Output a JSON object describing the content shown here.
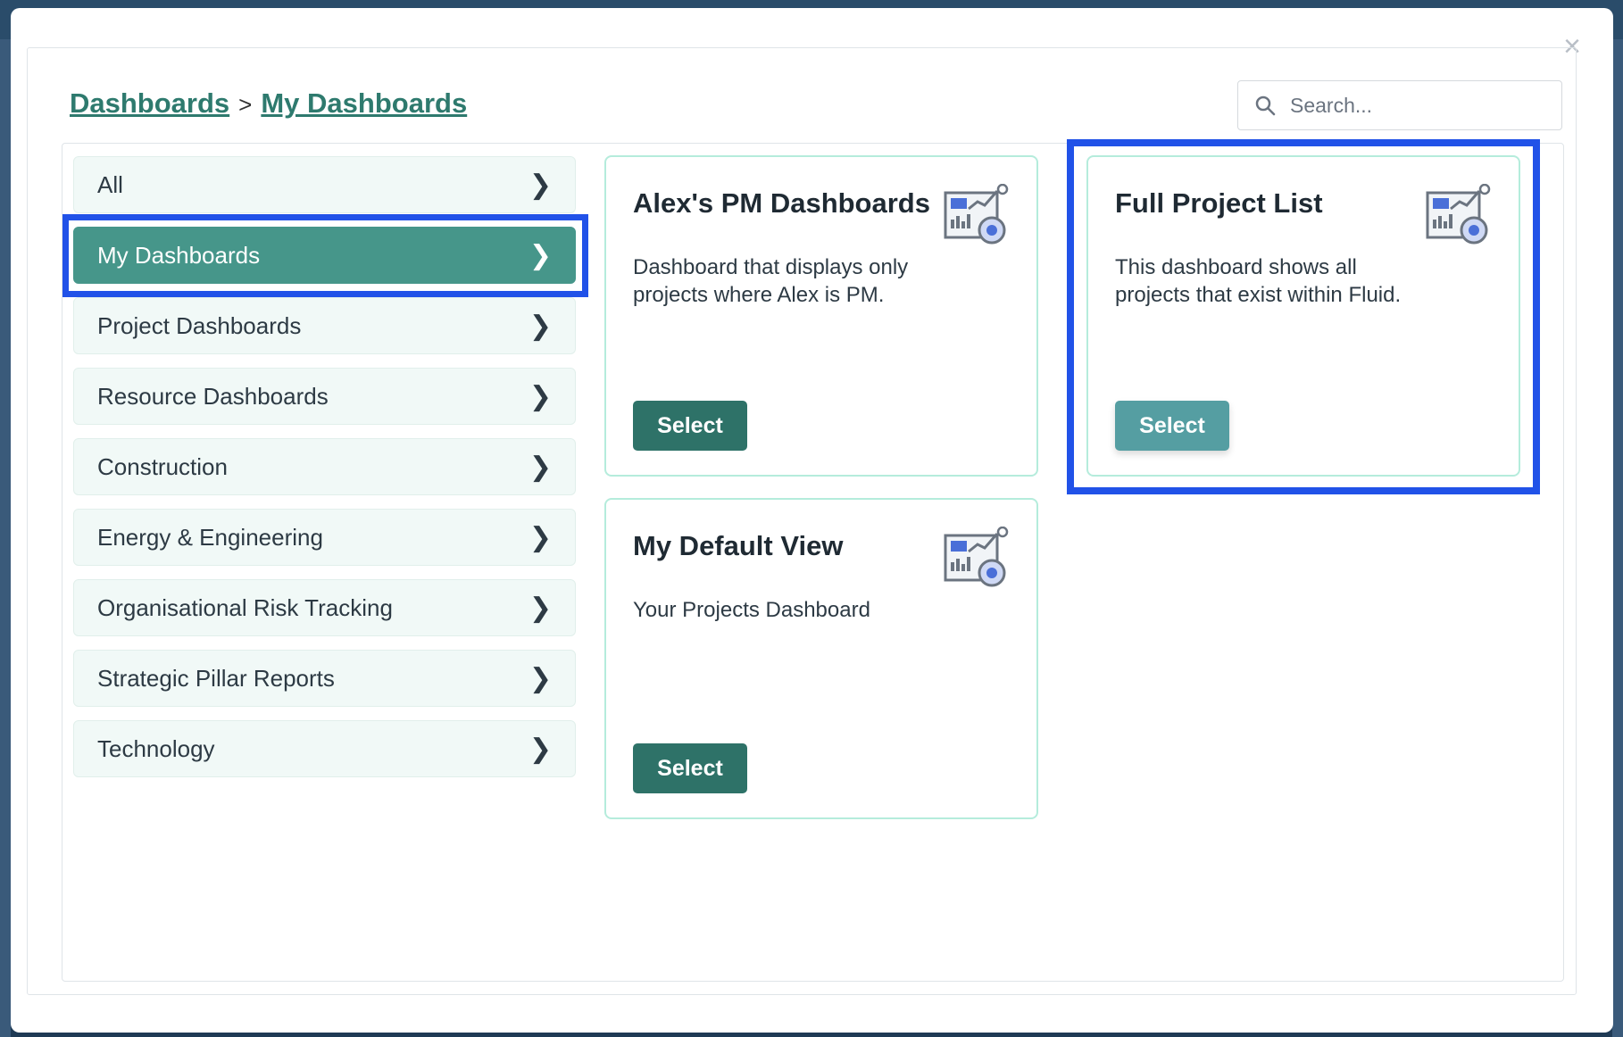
{
  "modal": {
    "close_label": "×",
    "breadcrumb": {
      "root": "Dashboards",
      "separator": ">",
      "current": "My Dashboards"
    },
    "search": {
      "placeholder": "Search..."
    }
  },
  "sidebar": {
    "items": [
      {
        "label": "All",
        "active": false
      },
      {
        "label": "My Dashboards",
        "active": true
      },
      {
        "label": "Project Dashboards",
        "active": false
      },
      {
        "label": "Resource Dashboards",
        "active": false
      },
      {
        "label": "Construction",
        "active": false
      },
      {
        "label": "Energy & Engineering",
        "active": false
      },
      {
        "label": "Organisational Risk Tracking",
        "active": false
      },
      {
        "label": "Strategic Pillar Reports",
        "active": false
      },
      {
        "label": "Technology",
        "active": false
      }
    ]
  },
  "cards": [
    {
      "title": "Alex's PM Dashboards",
      "description": "Dashboard that displays only projects where Alex is PM.",
      "button": "Select",
      "icon": "dashboard-chart-icon"
    },
    {
      "title": "Full Project List",
      "description": "This dashboard shows all projects that exist within Fluid.",
      "button": "Select",
      "icon": "dashboard-chart-icon"
    },
    {
      "title": "My Default View",
      "description": "Your Projects Dashboard",
      "button": "Select",
      "icon": "dashboard-chart-icon"
    }
  ],
  "colors": {
    "accent": "#46968a",
    "button": "#2e7268",
    "button_hover": "#559ea2",
    "highlight": "#2152e8",
    "link": "#2e7a6e"
  }
}
